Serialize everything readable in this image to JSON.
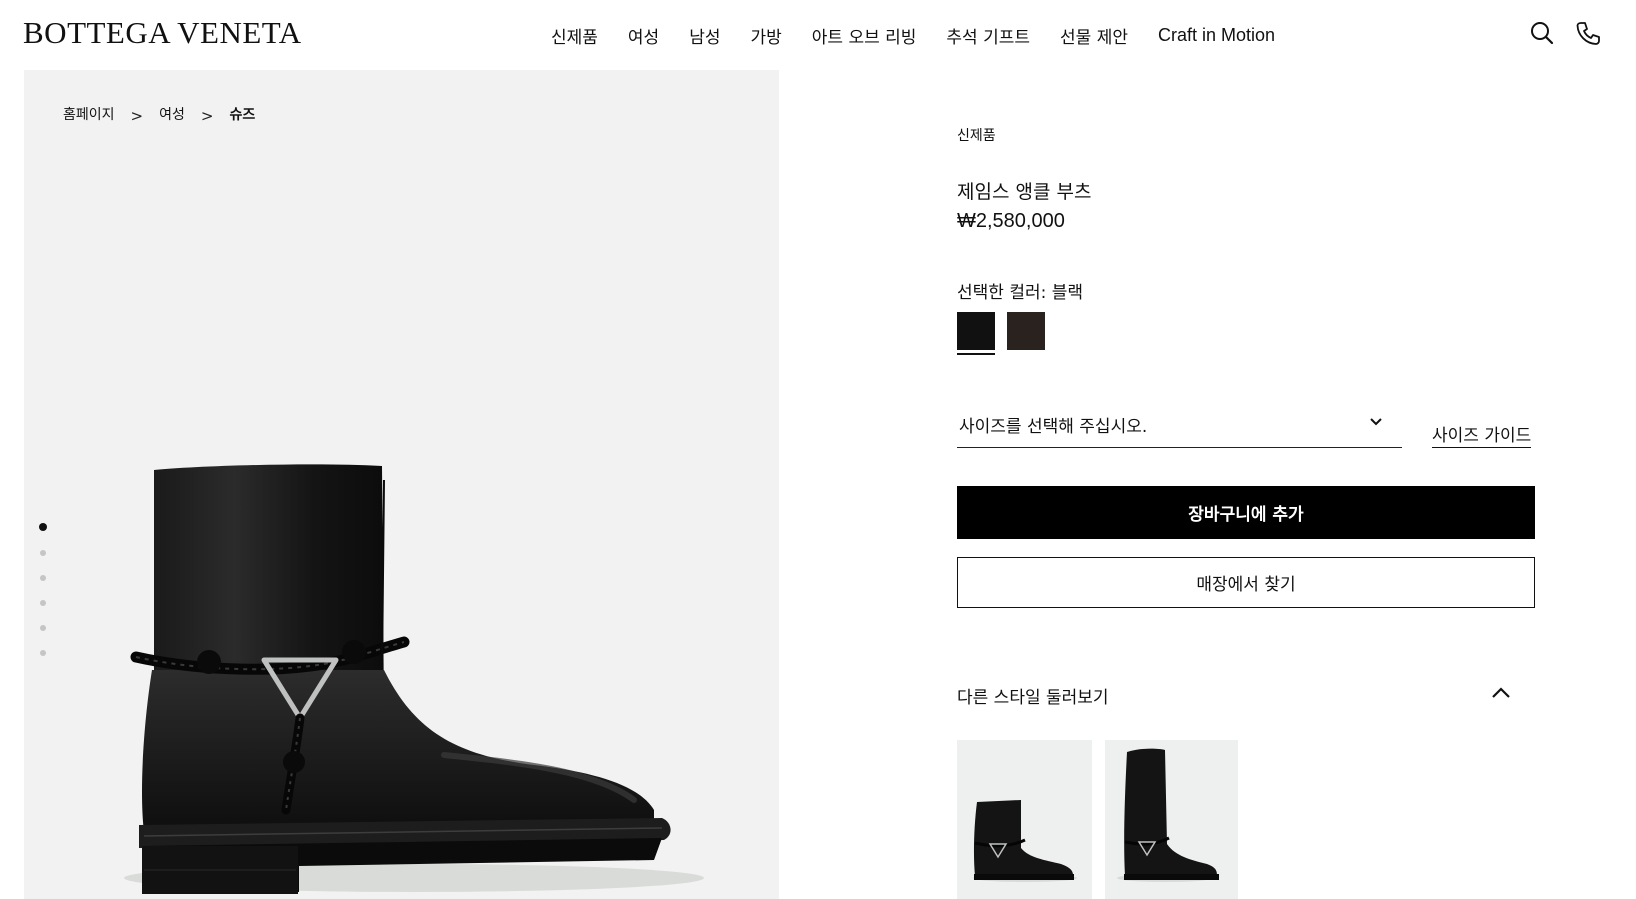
{
  "header": {
    "logo": "BOTTEGA VENETA",
    "nav": [
      "신제품",
      "여성",
      "남성",
      "가방",
      "아트 오브 리빙",
      "추석 기프트",
      "선물 제안",
      "Craft in Motion"
    ],
    "icons": {
      "search": "search-icon",
      "phone": "phone-icon"
    }
  },
  "breadcrumb": {
    "items": [
      "홈페이지",
      "여성",
      "슈즈"
    ],
    "separator": ">"
  },
  "gallery": {
    "image_count": 6,
    "active_index": 0,
    "background": "#f1f2f1"
  },
  "product": {
    "eyebrow": "신제품",
    "name": "제임스 앵클 부츠",
    "price": "₩2,580,000",
    "color_label": "선택한 컬러: 블랙",
    "swatches": [
      {
        "color": "#111111",
        "selected": true
      },
      {
        "color": "#2a221e",
        "selected": false
      }
    ],
    "size_placeholder": "사이즈를 선택해 주십시오.",
    "size_guide": "사이즈 가이드",
    "add_to_cart": "장바구니에 추가",
    "find_in_store": "매장에서 찾기"
  },
  "other_styles": {
    "title": "다른 스타일 둘러보기",
    "expanded": true,
    "items": [
      "ankle-boot-thumbnail",
      "tall-boot-thumbnail"
    ]
  },
  "colors": {
    "primary_button": "#000000",
    "text": "#111111",
    "page": "#ffffff"
  }
}
